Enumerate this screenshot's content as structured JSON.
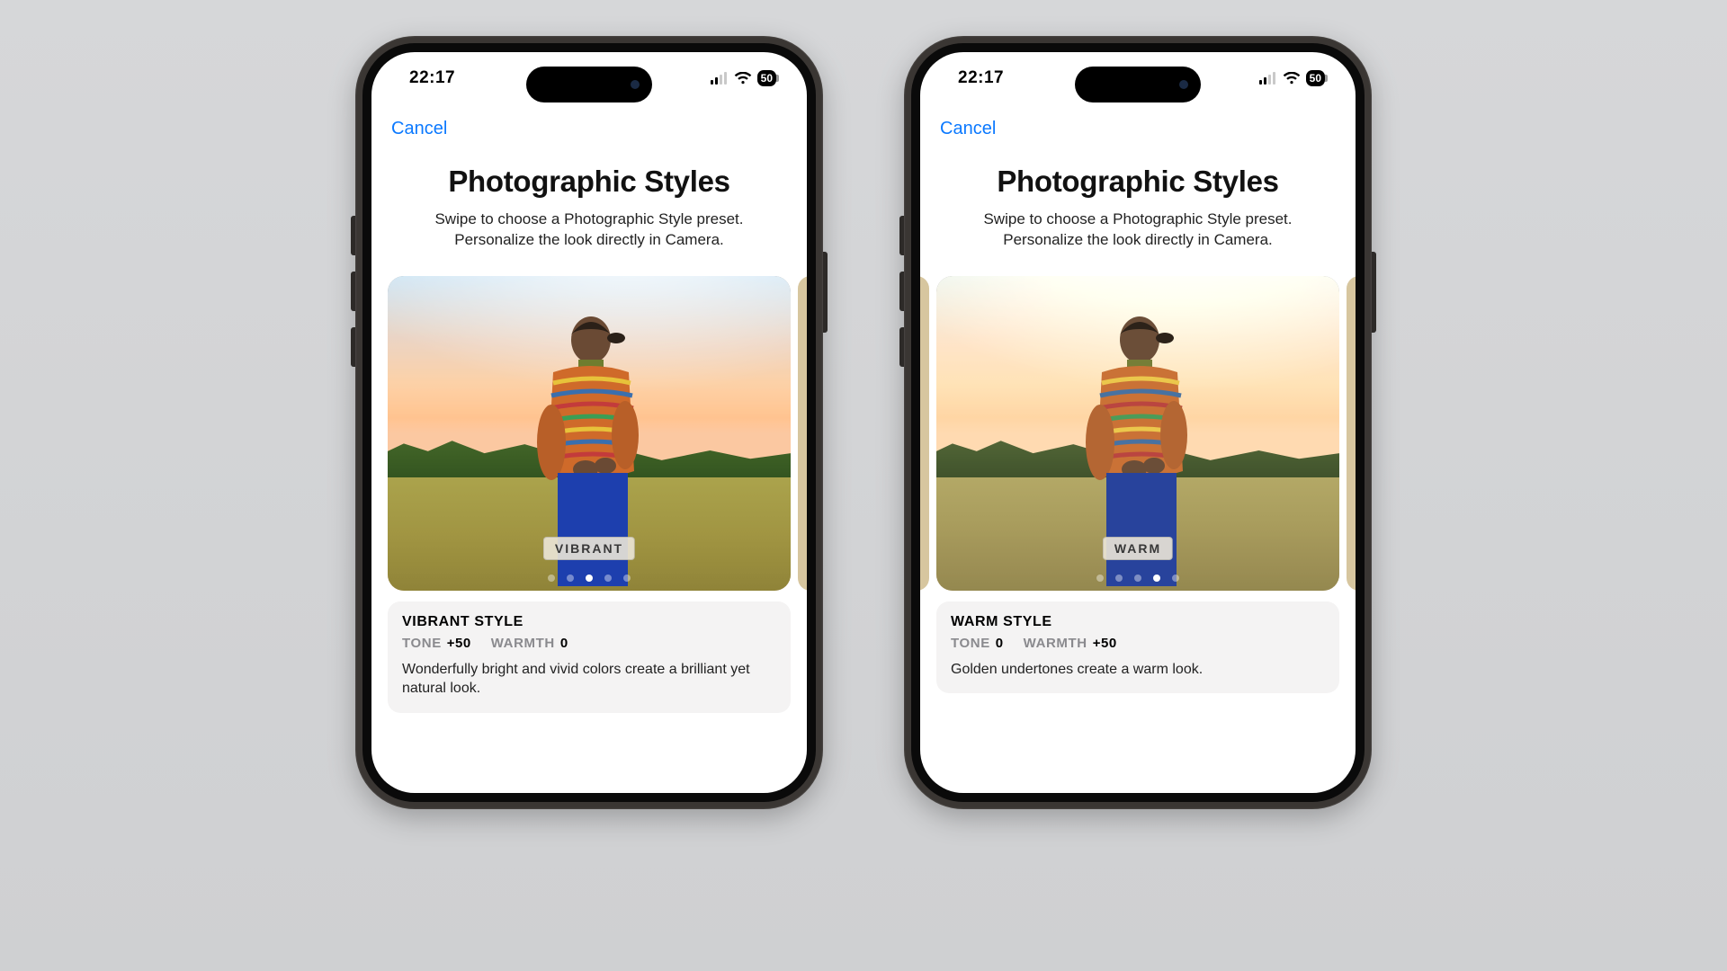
{
  "status": {
    "time": "22:17",
    "battery_percent": "50"
  },
  "common": {
    "cancel": "Cancel",
    "title": "Photographic Styles",
    "subtitle": "Swipe to choose a Photographic Style preset. Personalize the look directly in Camera.",
    "tone_label": "TONE",
    "warmth_label": "WARMTH",
    "page_dot_count": 5
  },
  "phones": [
    {
      "active_dot_index": 2,
      "preview_badge": "VIBRANT",
      "filter_class": "vibrant-filter",
      "card": {
        "title": "VIBRANT STYLE",
        "tone_value": "+50",
        "warmth_value": "0",
        "description": "Wonderfully bright and vivid colors create a brilliant yet natural look."
      }
    },
    {
      "active_dot_index": 3,
      "preview_badge": "WARM",
      "filter_class": "warm-filter",
      "card": {
        "title": "WARM STYLE",
        "tone_value": "0",
        "warmth_value": "+50",
        "description": "Golden undertones create a warm look."
      }
    }
  ]
}
